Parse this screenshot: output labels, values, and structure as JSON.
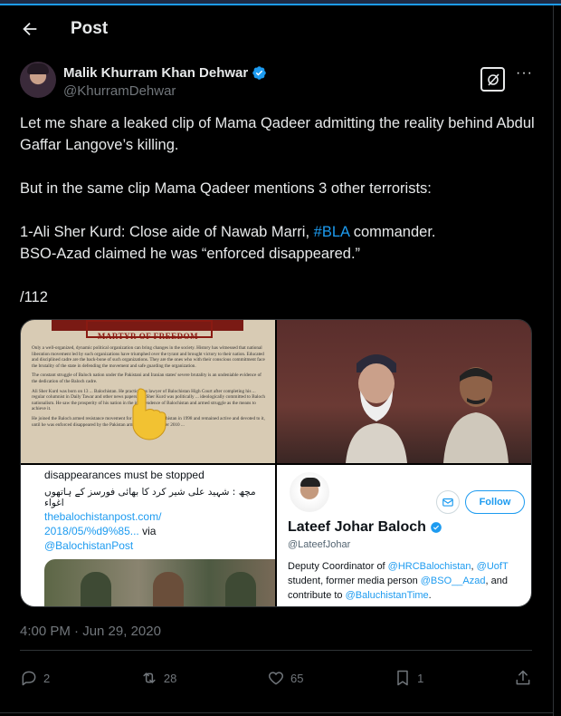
{
  "header": {
    "title": "Post"
  },
  "author": {
    "name": "Malik Khurram Khan Dehwar",
    "handle": "@KhurramDehwar"
  },
  "post": {
    "lines": [
      "Let me share a leaked clip of Mama Qadeer admitting the reality behind Abdul Gaffar Langove’s killing.",
      "But in the same clip Mama Qadeer mentions 3 other terrorists:",
      "1-Ali Sher Kurd: Close aide of Nawab Marri, ",
      "#BLA",
      " commander.",
      "BSO-Azad claimed he was “enforced disappeared.”",
      "/112"
    ],
    "timestamp": "4:00 PM · Jun 29, 2020"
  },
  "media": {
    "doc": {
      "heading": "MARTYR OF FREEDOM",
      "paragraphs": [
        "Only a well-organized, dynamic political organization can bring changes in the society. History has witnessed that national liberation movement led by such organizations have triumphed over the tyrant and brought victory to their nation. Educated and disciplined cadre are the back-bone of such organizations. They are the ones who with their conscious commitment face the brutality of the state in defending the movement and safe guarding the organization.",
        "The constant struggle of Baloch nation under the Pakistani and Iranian states' severe brutality is an undeniable evidence of the dedication of the Baloch cadre.",
        "Ali Sher Kurd was born on 13 ... Balochistan. He practiced as lawyer of Balochistan High Court after completing his ... regular columnist in Daily Tawar and other news papers. Ali Sher Kurd was politically ... ideologically committed to Baloch nationalism. He saw the prosperity of his nation in the independence of Balochistan and armed struggle as the means to achieve it.",
        "He joined the Baloch armed resistance movement for freedom of Balochistan in 1998 and remained active and devoted to it, until he was enforced disappeared by the Pakistan army on 21 September 2010 ..."
      ]
    },
    "tweet_crop": {
      "top_line": "disappearances must be stopped",
      "urdu": "مچھ : شہید علی شیر کرد کا بھائی فورسز کے ہاتھوں اغواء",
      "link1": "thebalochistanpost.com/",
      "link2": "2018/05/%d9%85...",
      "via": " via",
      "link3": "@BalochistanPost"
    },
    "profile": {
      "follow_label": "Follow",
      "name": "Lateef Johar Baloch",
      "handle": "@LateefJohar",
      "bio_1": "Deputy Coordinator of ",
      "bio_m1": "@HRCBalochistan",
      "bio_2": ", ",
      "bio_m2": "@UofT",
      "bio_3": " student, former media person ",
      "bio_m3": "@BSO__Azad",
      "bio_4": ", and contribute to ",
      "bio_m4": "@BaluchistanTime",
      "bio_5": "."
    }
  },
  "stats": {
    "replies": "2",
    "reposts": "28",
    "likes": "65",
    "bookmarks": "1"
  },
  "colors": {
    "background": "#000000",
    "text": "#e7e9ea",
    "muted": "#71767b",
    "accent": "#1d9bf0",
    "border": "#2f3336"
  },
  "icons": [
    "back-arrow-icon",
    "verified-badge-icon",
    "grok-icon",
    "more-icon",
    "reply-icon",
    "repost-icon",
    "like-icon",
    "bookmark-icon",
    "share-icon",
    "mail-icon"
  ]
}
